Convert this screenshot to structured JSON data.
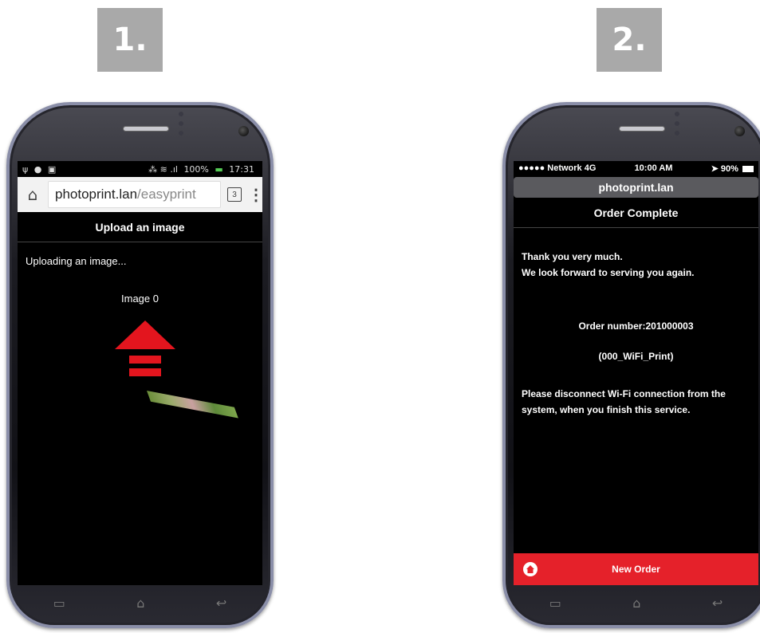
{
  "steps": {
    "step1": "1.",
    "step2": "2."
  },
  "phone1": {
    "status_time": "17:31",
    "status_battery": "100%",
    "url_host": "photoprint.lan",
    "url_path": "/easyprint",
    "tab_count": "3",
    "header_title": "Upload an image",
    "uploading_text": "Uploading an image...",
    "image_label": "Image 0",
    "arrow_color": "#e3151e"
  },
  "phone2": {
    "carrier": "●●●●● Network  4G",
    "time": "10:00 AM",
    "battery": "90%",
    "url": "photoprint.lan",
    "header_title": "Order Complete",
    "thanks_line1": "Thank you very much.",
    "thanks_line2": "We look forward to serving you again.",
    "order_number": "Order number:201000003",
    "order_code": "(000_WiFi_Print)",
    "disconnect_line1": "Please disconnect Wi-Fi connection from the",
    "disconnect_line2": "system, when you finish this service.",
    "new_order_label": "New Order",
    "accent_color": "#e5212a"
  }
}
